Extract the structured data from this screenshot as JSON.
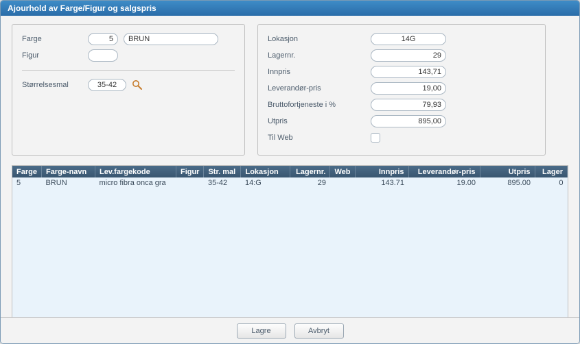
{
  "title": "Ajourhold av Farge/Figur og salgspris",
  "left": {
    "farge_label": "Farge",
    "farge_value": "5",
    "farge_name": "BRUN",
    "figur_label": "Figur",
    "figur_value": "",
    "storrelsesmal_label": "Størrelsesmal",
    "storrelsesmal_value": "35-42"
  },
  "right": {
    "lokasjon_label": "Lokasjon",
    "lokasjon_value": "14G",
    "lagernr_label": "Lagernr.",
    "lagernr_value": "29",
    "innpris_label": "Innpris",
    "innpris_value": "143,71",
    "levpris_label": "Leverandør-pris",
    "levpris_value": "19,00",
    "brutto_label": "Bruttofortjeneste i %",
    "brutto_value": "79,93",
    "utpris_label": "Utpris",
    "utpris_value": "895,00",
    "tilweb_label": "Til Web"
  },
  "grid": {
    "headers": {
      "farge": "Farge",
      "farge_navn": "Farge-navn",
      "lev_fargekode": "Lev.fargekode",
      "figur": "Figur",
      "str_mal": "Str. mal",
      "lokasjon": "Lokasjon",
      "lagernr": "Lagernr.",
      "web": "Web",
      "innpris": "Innpris",
      "leverandor_pris": "Leverandør-pris",
      "utpris": "Utpris",
      "lager": "Lager"
    },
    "row0": {
      "farge": "5",
      "farge_navn": "BRUN",
      "lev_fargekode": "micro fibra onca gra",
      "figur": "",
      "str_mal": "35-42",
      "lokasjon": "14:G",
      "lagernr": "29",
      "web": "",
      "innpris": "143.71",
      "leverandor_pris": "19.00",
      "utpris": "895.00",
      "lager": "0"
    }
  },
  "buttons": {
    "save": "Lagre",
    "cancel": "Avbryt"
  }
}
